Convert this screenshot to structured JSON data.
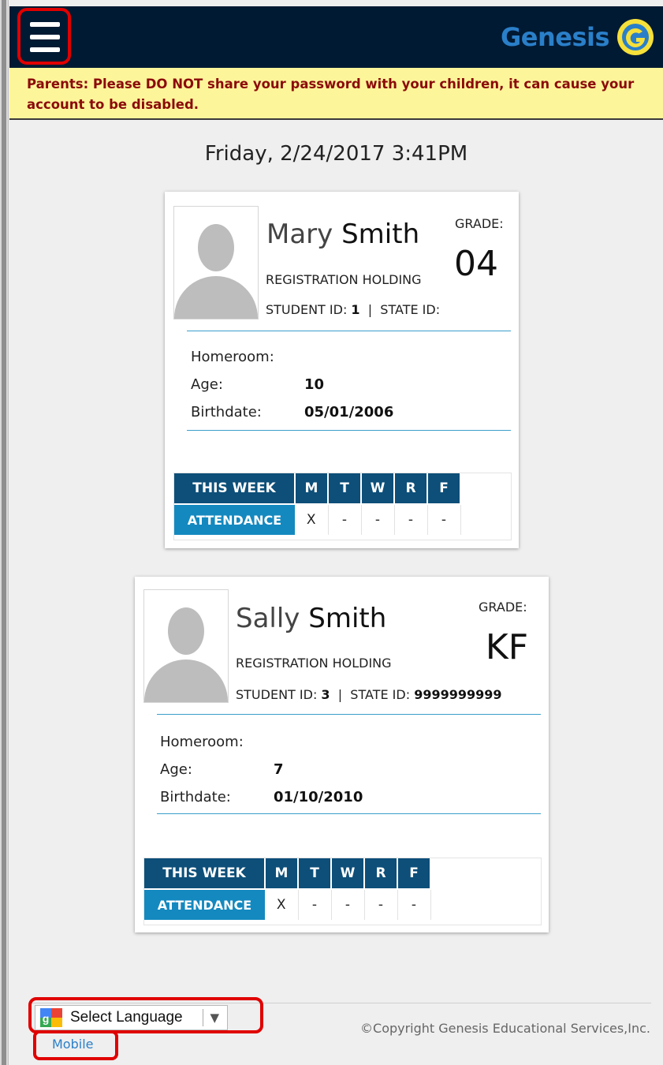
{
  "header": {
    "logo_text": "Genesis",
    "menu_icon": "hamburger-menu-icon"
  },
  "warning": {
    "text": "Parents: Please DO NOT share your password with your children, it can cause your account to be disabled."
  },
  "date": "Friday, 2/24/2017 3:41PM",
  "students": [
    {
      "first_name": "Mary",
      "last_name": "Smith",
      "grade_label": "GRADE:",
      "grade": "04",
      "status": "REGISTRATION HOLDING",
      "student_id_label": "STUDENT ID:",
      "student_id": "1",
      "separator": "|",
      "state_id_label": "STATE ID:",
      "state_id": "",
      "homeroom_label": "Homeroom:",
      "homeroom": "",
      "age_label": "Age:",
      "age": "10",
      "birthdate_label": "Birthdate:",
      "birthdate": "05/01/2006",
      "attendance": {
        "week_label": "THIS WEEK",
        "row_label": "ATTENDANCE",
        "days": [
          "M",
          "T",
          "W",
          "R",
          "F"
        ],
        "marks": [
          "X",
          "-",
          "-",
          "-",
          "-"
        ]
      }
    },
    {
      "first_name": "Sally",
      "last_name": "Smith",
      "grade_label": "GRADE:",
      "grade": "KF",
      "status": "REGISTRATION HOLDING",
      "student_id_label": "STUDENT ID:",
      "student_id": "3",
      "separator": "|",
      "state_id_label": "STATE ID:",
      "state_id": "9999999999",
      "homeroom_label": "Homeroom:",
      "homeroom": "",
      "age_label": "Age:",
      "age": "7",
      "birthdate_label": "Birthdate:",
      "birthdate": "01/10/2010",
      "attendance": {
        "week_label": "THIS WEEK",
        "row_label": "ATTENDANCE",
        "days": [
          "M",
          "T",
          "W",
          "R",
          "F"
        ],
        "marks": [
          "X",
          "-",
          "-",
          "-",
          "-"
        ]
      }
    }
  ],
  "footer": {
    "select_language": "Select Language",
    "dropdown_arrow": "▼",
    "mobile_link": "Mobile",
    "copyright": "©Copyright Genesis Educational Services,Inc."
  },
  "colors": {
    "header_bg": "#001a33",
    "logo_blue": "#2a7fc9",
    "logo_yellow": "#f6e03a",
    "warning_bg": "#fdf59a",
    "warning_text": "#8b0b0b",
    "table_dark": "#0d4f79",
    "table_light": "#1489bf",
    "highlight_red": "#e00000"
  }
}
